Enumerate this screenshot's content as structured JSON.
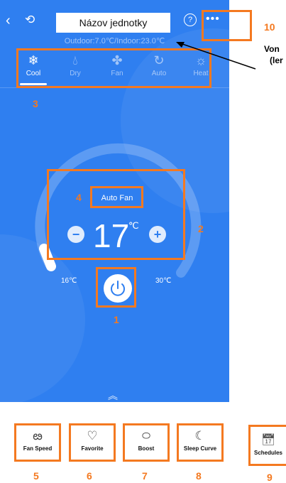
{
  "header": {
    "title": "Názov jednotky",
    "subtitle": "Outdoor:7.0℃/Indoor:23.0℃",
    "back_icon": "back-arrow-icon",
    "refresh_icon": "refresh-icon",
    "help_icon": "help-icon",
    "more_icon": "more-icon"
  },
  "modes": [
    {
      "label": "Cool",
      "icon": "snowflake-icon",
      "active": true
    },
    {
      "label": "Dry",
      "icon": "droplet-icon",
      "active": false
    },
    {
      "label": "Fan",
      "icon": "fan-icon",
      "active": false
    },
    {
      "label": "Auto",
      "icon": "auto-cycle-icon",
      "active": false
    },
    {
      "label": "Heat",
      "icon": "sun-icon",
      "active": false
    }
  ],
  "control": {
    "fan_mode": "Auto Fan",
    "temperature": "17",
    "unit": "℃",
    "minus": "−",
    "plus": "+",
    "min_label": "16℃",
    "max_label": "30℃"
  },
  "bottom_bar": [
    {
      "label": "Fan Speed",
      "icon": "fan-speed-icon"
    },
    {
      "label": "Favorite",
      "icon": "heart-icon"
    },
    {
      "label": "Boost",
      "icon": "boost-icon"
    },
    {
      "label": "Sleep Curve",
      "icon": "moon-icon"
    }
  ],
  "schedules": {
    "label": "Schedules",
    "icon": "calendar-clock-icon"
  },
  "annotations": {
    "n1": "1",
    "n2": "2",
    "n3": "3",
    "n4": "4",
    "n5": "5",
    "n6": "6",
    "n7": "7",
    "n8": "8",
    "n9": "9",
    "n10": "10",
    "side_text_1": "Von",
    "side_text_2": "(ler"
  },
  "colors": {
    "background": "#2f7ff0",
    "annotation": "#f47920"
  }
}
